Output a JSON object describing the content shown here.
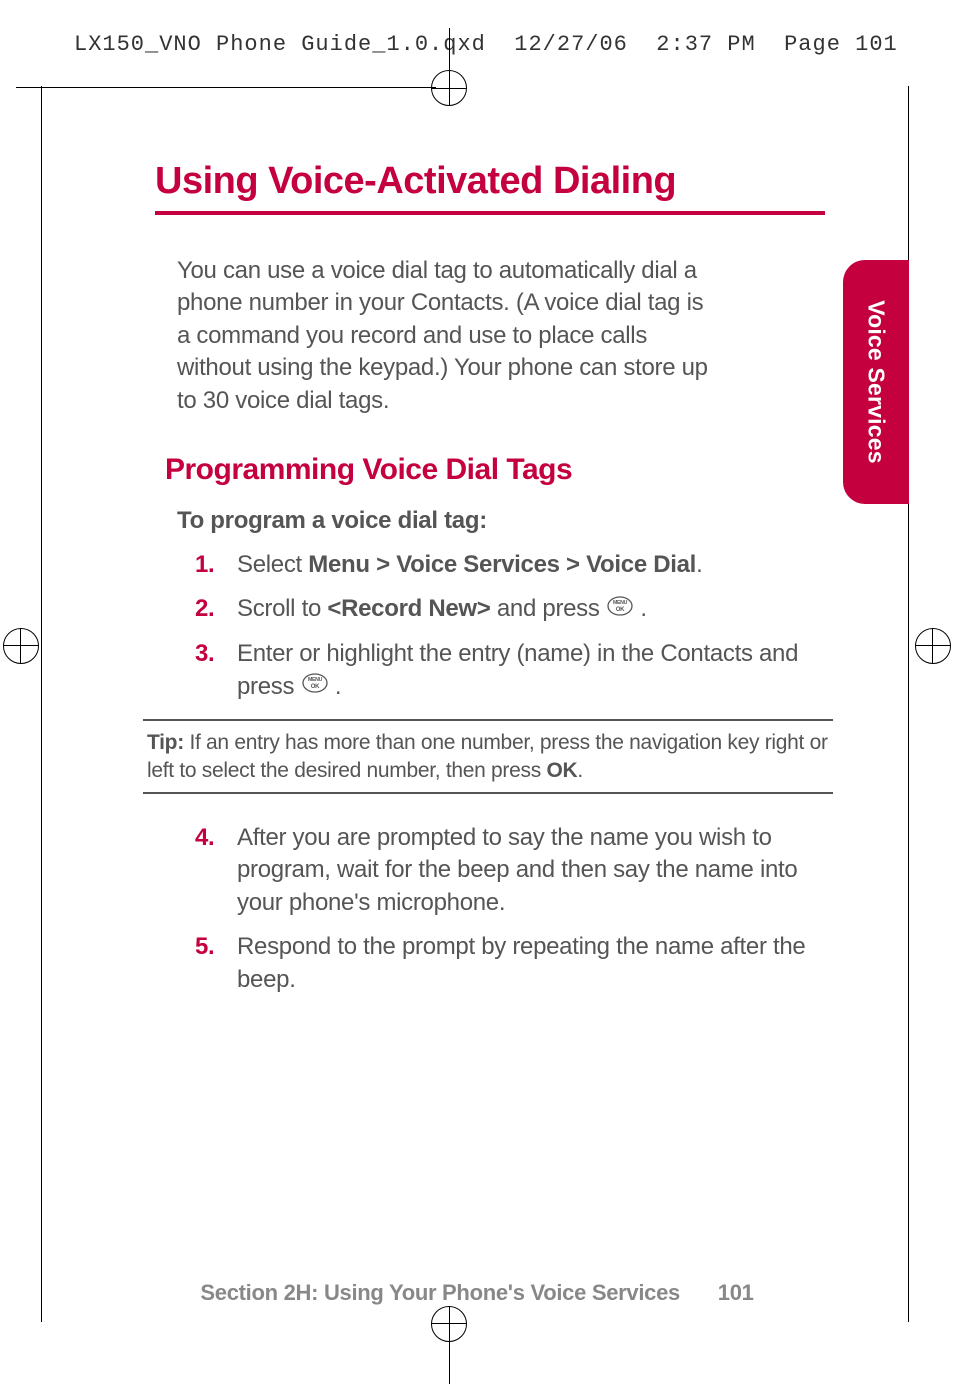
{
  "header_line": "LX150_VNO Phone Guide_1.0.qxd  12/27/06  2:37 PM  Page 101",
  "title": "Using Voice-Activated Dialing",
  "intro": "You can use a voice dial tag to automatically dial a phone number in your Contacts. (A voice dial tag is a command you record and use to place calls without using the keypad.) Your phone can store up to 30 voice dial tags.",
  "h2": "Programming Voice Dial Tags",
  "subhead": "To program a voice dial tag:",
  "steps": {
    "n1": "1.",
    "s1a": "Select ",
    "s1b": "Menu > Voice Services > Voice Dial",
    "s1c": ".",
    "n2": "2.",
    "s2a": "Scroll to ",
    "s2b": "<Record New>",
    "s2c": " and press ",
    "s2d": " .",
    "n3": "3.",
    "s3a": "Enter or highlight the entry (name) in the Contacts and press ",
    "s3b": " .",
    "n4": "4.",
    "s4": "After you are prompted to say the name you wish to program, wait for the beep and then say the name into your phone's microphone.",
    "n5": "5.",
    "s5": "Respond to the prompt by repeating the name after the beep."
  },
  "tip_label": "Tip:",
  "tip_text": " If an entry has more than one number, press the navigation key right or left to select the desired number, then press ",
  "tip_ok": "OK",
  "tip_end": ".",
  "side_tab": "Voice Services",
  "footer_section": "Section 2H: Using Your Phone's Voice Services",
  "footer_page": "101",
  "icon_label_top": "MENU",
  "icon_label_bot": "OK"
}
